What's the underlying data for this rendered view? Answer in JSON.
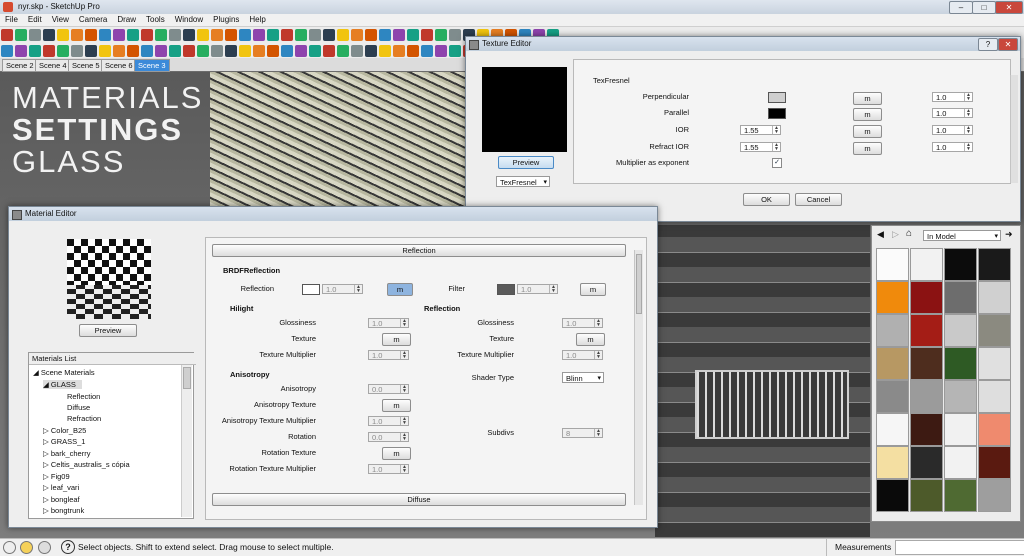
{
  "app": {
    "window_title": "nyr.skp - SketchUp Pro",
    "menu": [
      "File",
      "Edit",
      "View",
      "Camera",
      "Draw",
      "Tools",
      "Window",
      "Plugins",
      "Help"
    ],
    "scene_tabs": [
      "Scene 2",
      "Scene 4",
      "Scene 5",
      "Scene 6",
      "Scene 3"
    ],
    "active_scene": "Scene 3"
  },
  "overlay_title": {
    "line1": "MATERIALS",
    "line2": "SETTINGS",
    "line3": "GLASS"
  },
  "texture_editor": {
    "title": "Texture Editor",
    "preview_button": "Preview",
    "texture_type": "TexFresnel",
    "section": "TexFresnel",
    "rows": [
      {
        "label": "Perpendicular",
        "value": "",
        "map": "m",
        "mult": "1.0",
        "swatch": "#cfcfcf"
      },
      {
        "label": "Parallel",
        "value": "",
        "map": "m",
        "mult": "1.0",
        "swatch": "#000000"
      },
      {
        "label": "IOR",
        "value": "1.55",
        "map": "m",
        "mult": "1.0"
      },
      {
        "label": "Refract IOR",
        "value": "1.55",
        "map": "m",
        "mult": "1.0"
      }
    ],
    "checkbox_label": "Multiplier as exponent",
    "ok": "OK",
    "cancel": "Cancel"
  },
  "material_editor": {
    "title": "Material Editor",
    "preview_button": "Preview",
    "reflection_header": "Reflection",
    "diffuse_header": "Diffuse",
    "brdf_title": "BRDFReflection",
    "reflection_label": "Reflection",
    "reflection_value": "1.0",
    "reflection_map": "m",
    "filter_label": "Filter",
    "filter_value": "1.0",
    "filter_map": "m",
    "hilight": {
      "title": "Hilight",
      "glossiness_label": "Glossiness",
      "glossiness": "1.0",
      "texture_label": "Texture",
      "texture_map": "m",
      "texmult_label": "Texture Multiplier",
      "texmult": "1.0"
    },
    "reflection_group": {
      "title": "Reflection",
      "glossiness_label": "Glossiness",
      "glossiness": "1.0",
      "texture_label": "Texture",
      "texture_map": "m",
      "texmult_label": "Texture Multiplier",
      "texmult": "1.0"
    },
    "anisotropy": {
      "title": "Anisotropy",
      "aniso_label": "Anisotropy",
      "aniso": "0.0",
      "aniso_tex_label": "Anisotropy Texture",
      "aniso_tex_map": "m",
      "aniso_mult_label": "Anisotropy Texture Multiplier",
      "aniso_mult": "1.0",
      "rotation_label": "Rotation",
      "rotation": "0.0",
      "rotation_tex_label": "Rotation Texture",
      "rotation_tex_map": "m",
      "rotation_mult_label": "Rotation Texture Multiplier",
      "rotation_mult": "1.0"
    },
    "shader_type_label": "Shader Type",
    "shader_type": "Blinn",
    "subdivs_label": "Subdivs",
    "subdivs": "8",
    "materials_list": {
      "header": "Materials List",
      "items": [
        "Scene Materials",
        "GLASS",
        "Reflection",
        "Diffuse",
        "Refraction",
        "Color_B25",
        "GRASS_1",
        "bark_cherry",
        "Celtis_australis_s cópia",
        "Fig09",
        "leaf_vari",
        "bongleaf",
        "bongtrunk"
      ]
    }
  },
  "material_browser": {
    "dropdown": "In Model",
    "thumb_colors": [
      "#fbfbfb",
      "#f2f2f2",
      "#0c0c0c",
      "#1a1a1a",
      "#f08a0c",
      "#8b1212",
      "#6d6d6d",
      "#d0d0d0",
      "#b0b0b0",
      "#a41d16",
      "#c9c9c9",
      "#8b8a80",
      "#b79863",
      "#4e2d1e",
      "#2e5a24",
      "#e0e0e0",
      "#8a8a8a",
      "#9b9b9b",
      "#b5b5b5",
      "#dedede",
      "#f6f6f6",
      "#3d1a12",
      "#f1f1f1",
      "#ef8a6e",
      "#f4dfa2",
      "#2a2a2a",
      "#f2f2f2",
      "#5a1a10",
      "#0a0a0a",
      "#4d5a2a",
      "#4f6a32",
      "#9e9e9e"
    ]
  },
  "status": {
    "message": "Select objects. Shift to extend select. Drag mouse to select multiple.",
    "measurements_label": "Measurements"
  }
}
